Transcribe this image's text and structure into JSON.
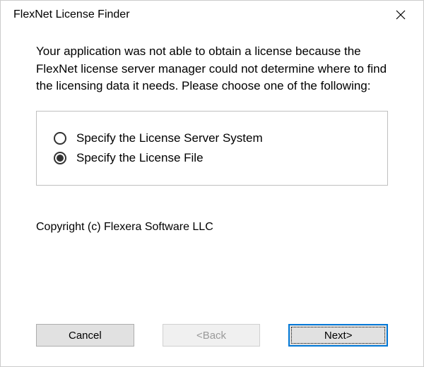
{
  "titlebar": {
    "title": "FlexNet License Finder"
  },
  "content": {
    "message": "Your application was not able to obtain a license because the FlexNet license server manager could not determine where to find the licensing data it needs.  Please choose one of the following:",
    "options": [
      {
        "label": "Specify the License Server System",
        "selected": false
      },
      {
        "label": "Specify the License File",
        "selected": true
      }
    ],
    "copyright": "Copyright (c) Flexera Software LLC"
  },
  "buttons": {
    "cancel": "Cancel",
    "back": "<Back",
    "next": "Next>"
  }
}
